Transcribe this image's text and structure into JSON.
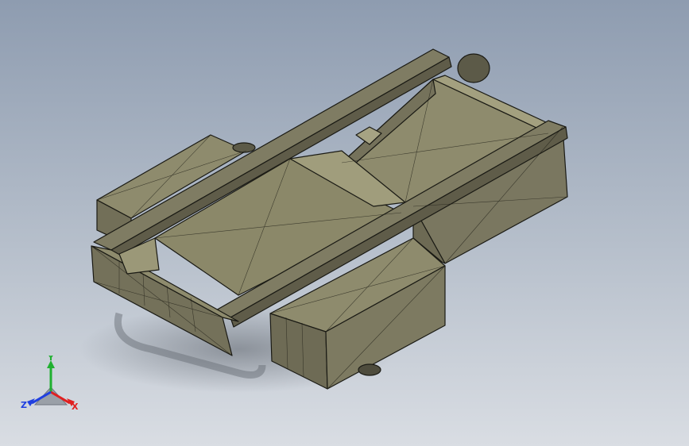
{
  "viewport": {
    "background_top": "#8e9cb0",
    "background_bottom": "#d9dde3",
    "model_color": "#8a876a",
    "edge_color": "#1a1a14"
  },
  "triad": {
    "icon": "triad-icon",
    "x_label": "X",
    "y_label": "Y",
    "z_label": "Z",
    "x_color": "#e02020",
    "y_color": "#20b030",
    "z_color": "#2040e0"
  }
}
